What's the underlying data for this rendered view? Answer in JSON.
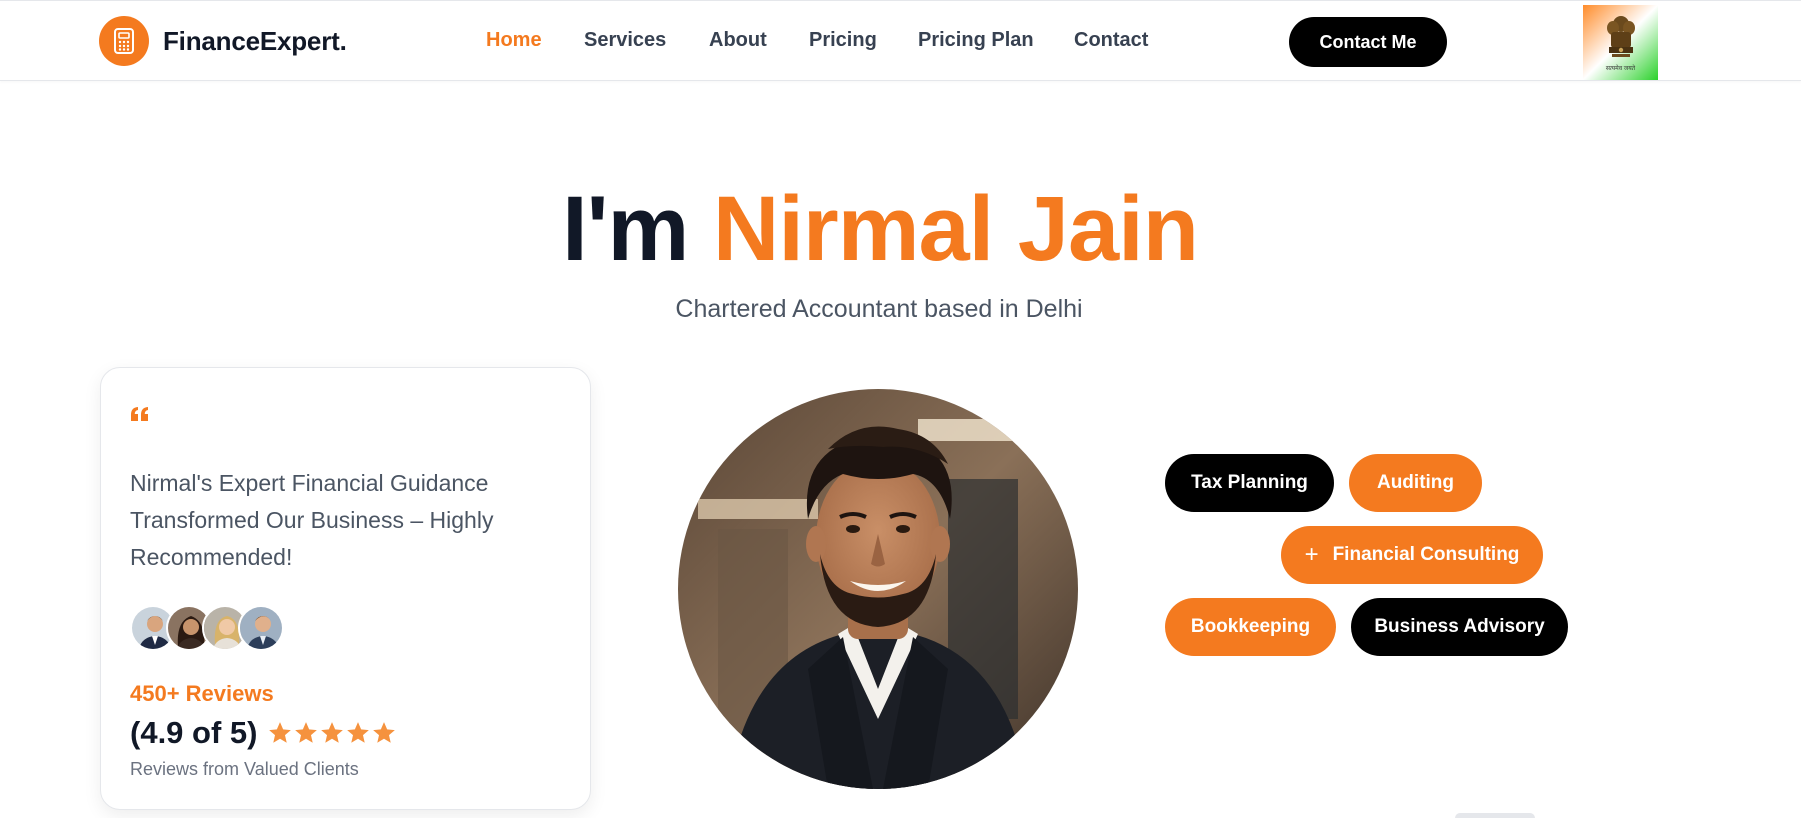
{
  "header": {
    "logo_icon": "calculator-icon",
    "logo_text": "FinanceExpert.",
    "nav": [
      {
        "label": "Home",
        "active": true
      },
      {
        "label": "Services",
        "active": false
      },
      {
        "label": "About",
        "active": false
      },
      {
        "label": "Pricing",
        "active": false
      },
      {
        "label": "Pricing Plan",
        "active": false
      },
      {
        "label": "Contact",
        "active": false
      }
    ],
    "contact_button": "Contact Me",
    "emblem_caption": "सत्यमेव जयते"
  },
  "hero": {
    "intro": "I'm ",
    "name": "Nirmal Jain",
    "subtitle": "Chartered Accountant based in Delhi"
  },
  "testimonial": {
    "quote_icon": "quote-icon",
    "quote": "Nirmal's Expert Financial Guidance Transformed Our Business – Highly Recommended!",
    "reviews_count": "450+ Reviews",
    "rating_text": "(4.9 of 5)",
    "rating_stars": 5,
    "caption": "Reviews from Valued Clients"
  },
  "services": {
    "tags": [
      {
        "label": "Tax Planning",
        "style": "dark"
      },
      {
        "label": "Auditing",
        "style": "orange"
      },
      {
        "label": "Financial Consulting",
        "style": "orange",
        "icon": "plus-icon"
      },
      {
        "label": "Bookkeeping",
        "style": "orange"
      },
      {
        "label": "Business Advisory",
        "style": "dark"
      }
    ]
  },
  "colors": {
    "accent": "#f47a1f",
    "dark": "#111827",
    "button": "#000000"
  }
}
